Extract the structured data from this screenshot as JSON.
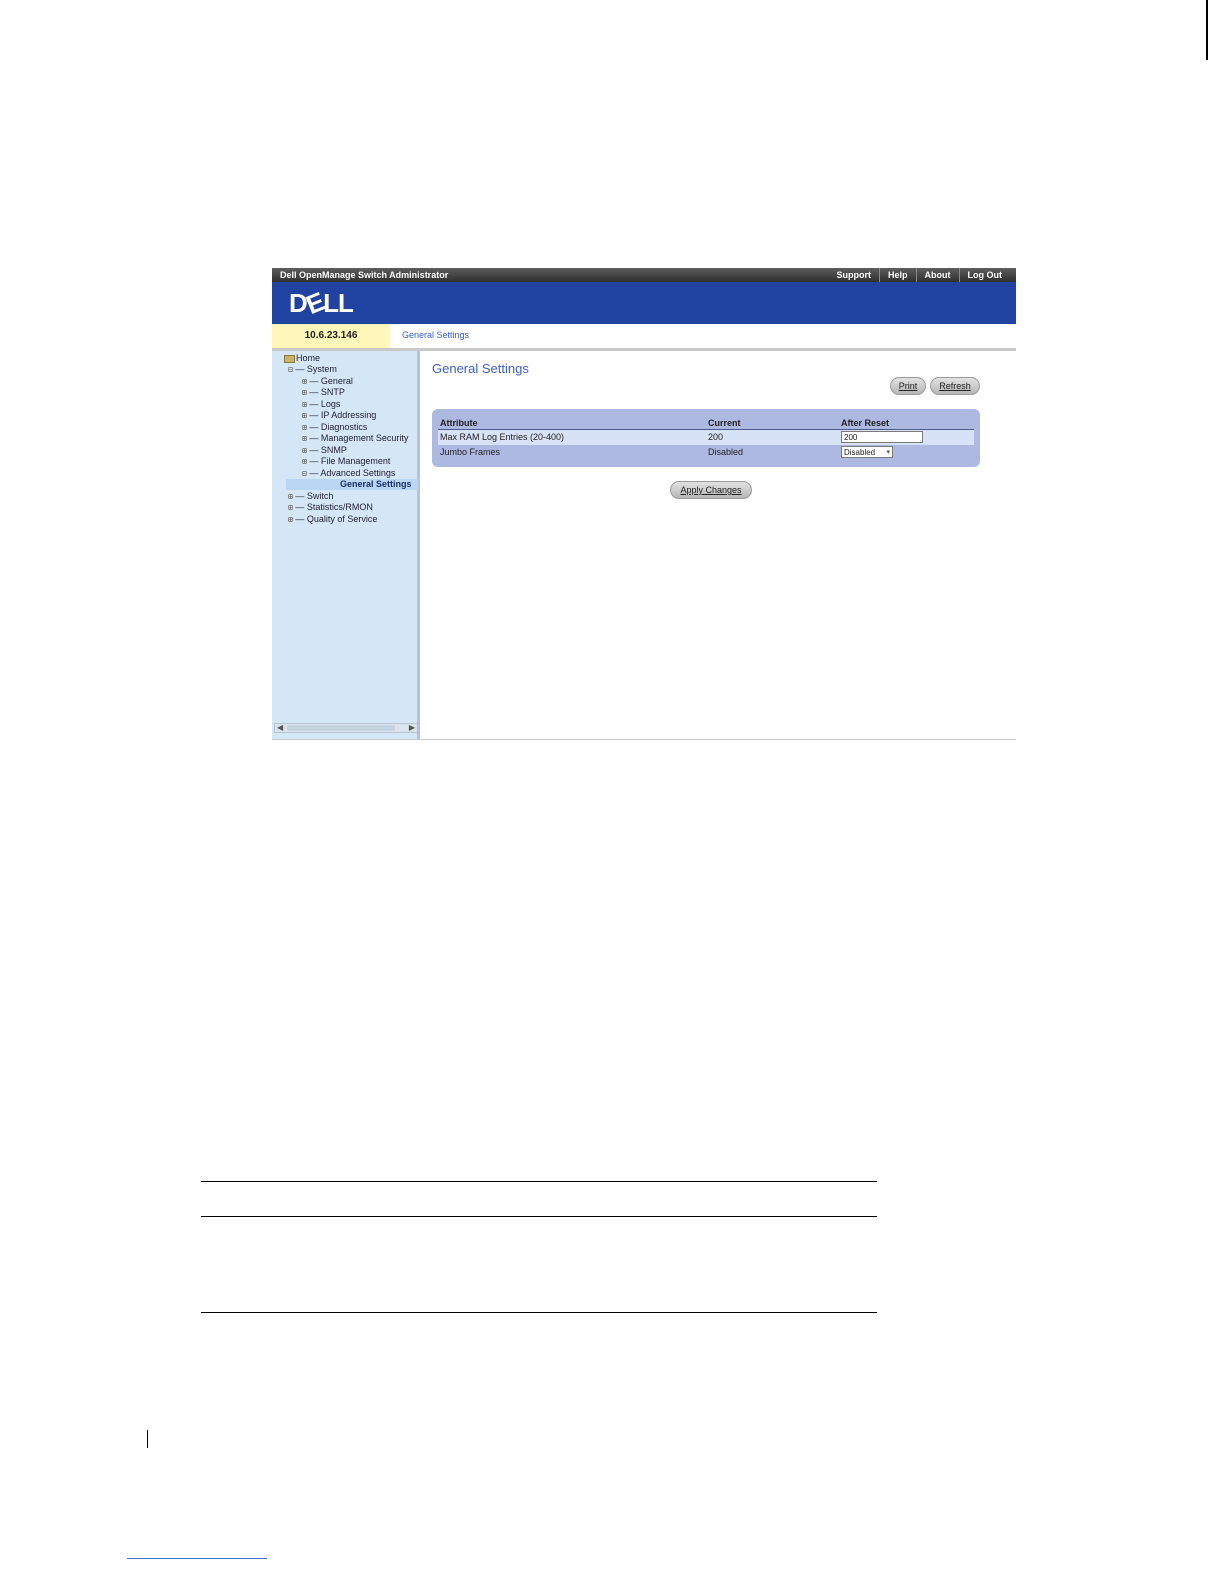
{
  "app": {
    "title": "Dell OpenManage Switch Administrator",
    "top_links": [
      "Support",
      "Help",
      "About",
      "Log Out"
    ],
    "logo": {
      "pre": "D",
      "e": "E",
      "post": "LL"
    }
  },
  "header": {
    "ip": "10.6.23.146",
    "breadcrumb": "General Settings"
  },
  "tree": {
    "home": "Home",
    "system": "System",
    "items": [
      "General",
      "SNTP",
      "Logs",
      "IP Addressing",
      "Diagnostics",
      "Management Security",
      "SNMP",
      "File Management",
      "Advanced Settings"
    ],
    "selected": "General Settings",
    "bottom": [
      "Switch",
      "Statistics/RMON",
      "Quality of Service"
    ],
    "expander_plus": "⊞",
    "expander_minus": "⊟",
    "scroll_left": "◀",
    "scroll_right": "▶"
  },
  "main": {
    "title": "General Settings",
    "print_button": "Print",
    "refresh_button": "Refresh",
    "apply_button": "Apply Changes",
    "table": {
      "headers": [
        "Attribute",
        "Current",
        "After Reset"
      ],
      "rows": [
        {
          "attribute": "Max RAM Log Entries (20-400)",
          "current": "200",
          "after_reset": "200"
        },
        {
          "attribute": "Jumbo Frames",
          "current": "Disabled",
          "after_reset": "Disabled"
        }
      ],
      "select_chevron": "▾"
    }
  }
}
